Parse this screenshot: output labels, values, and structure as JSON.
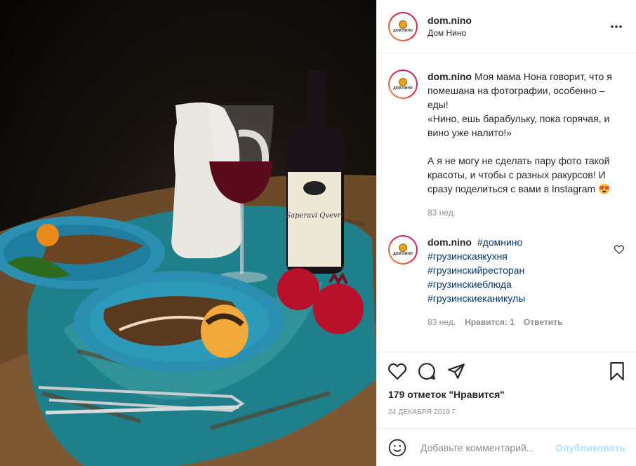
{
  "post": {
    "image_alt": "",
    "username": "dom.nino",
    "location": "Дом Нино",
    "avatar_logo_text": "ДОМ НИНО",
    "caption": {
      "username": "dom.nino",
      "text": "Моя мама Нона говорит, что я помешана на фотографии, особенно – еды!\n«Нино, ешь барабульку, пока горячая, и вино уже налито!»\n\nА я не могу не сделать пару фото такой красоты, и чтобы с разных ракурсов! И сразу поделиться с вами в Instagram 😍",
      "time": "83 нед."
    },
    "comment": {
      "username": "dom.nino",
      "hashtags": [
        "#домнино",
        "#грузинскаякухня",
        "#грузинскийресторан",
        "#грузинскиеблюда",
        "#грузинскиеканикулы"
      ],
      "time": "83 нед.",
      "likes": "Нравится: 1",
      "reply": "Ответить"
    },
    "likes_text": "179 отметок \"Нравится\"",
    "date": "24 ДЕКАБРЯ 2019 Г.",
    "add_comment_placeholder": "Добавьте комментарий...",
    "publish_label": "Опубликовать",
    "wine_label_text": "Saperavi Qvevri"
  },
  "icons": [
    "more-icon",
    "heart-icon",
    "comment-icon",
    "share-icon",
    "bookmark-icon",
    "smile-icon"
  ],
  "colors": {
    "link": "#00376b",
    "muted": "#8e8e8e",
    "publish": "#b2dffc",
    "border": "#efefef"
  }
}
